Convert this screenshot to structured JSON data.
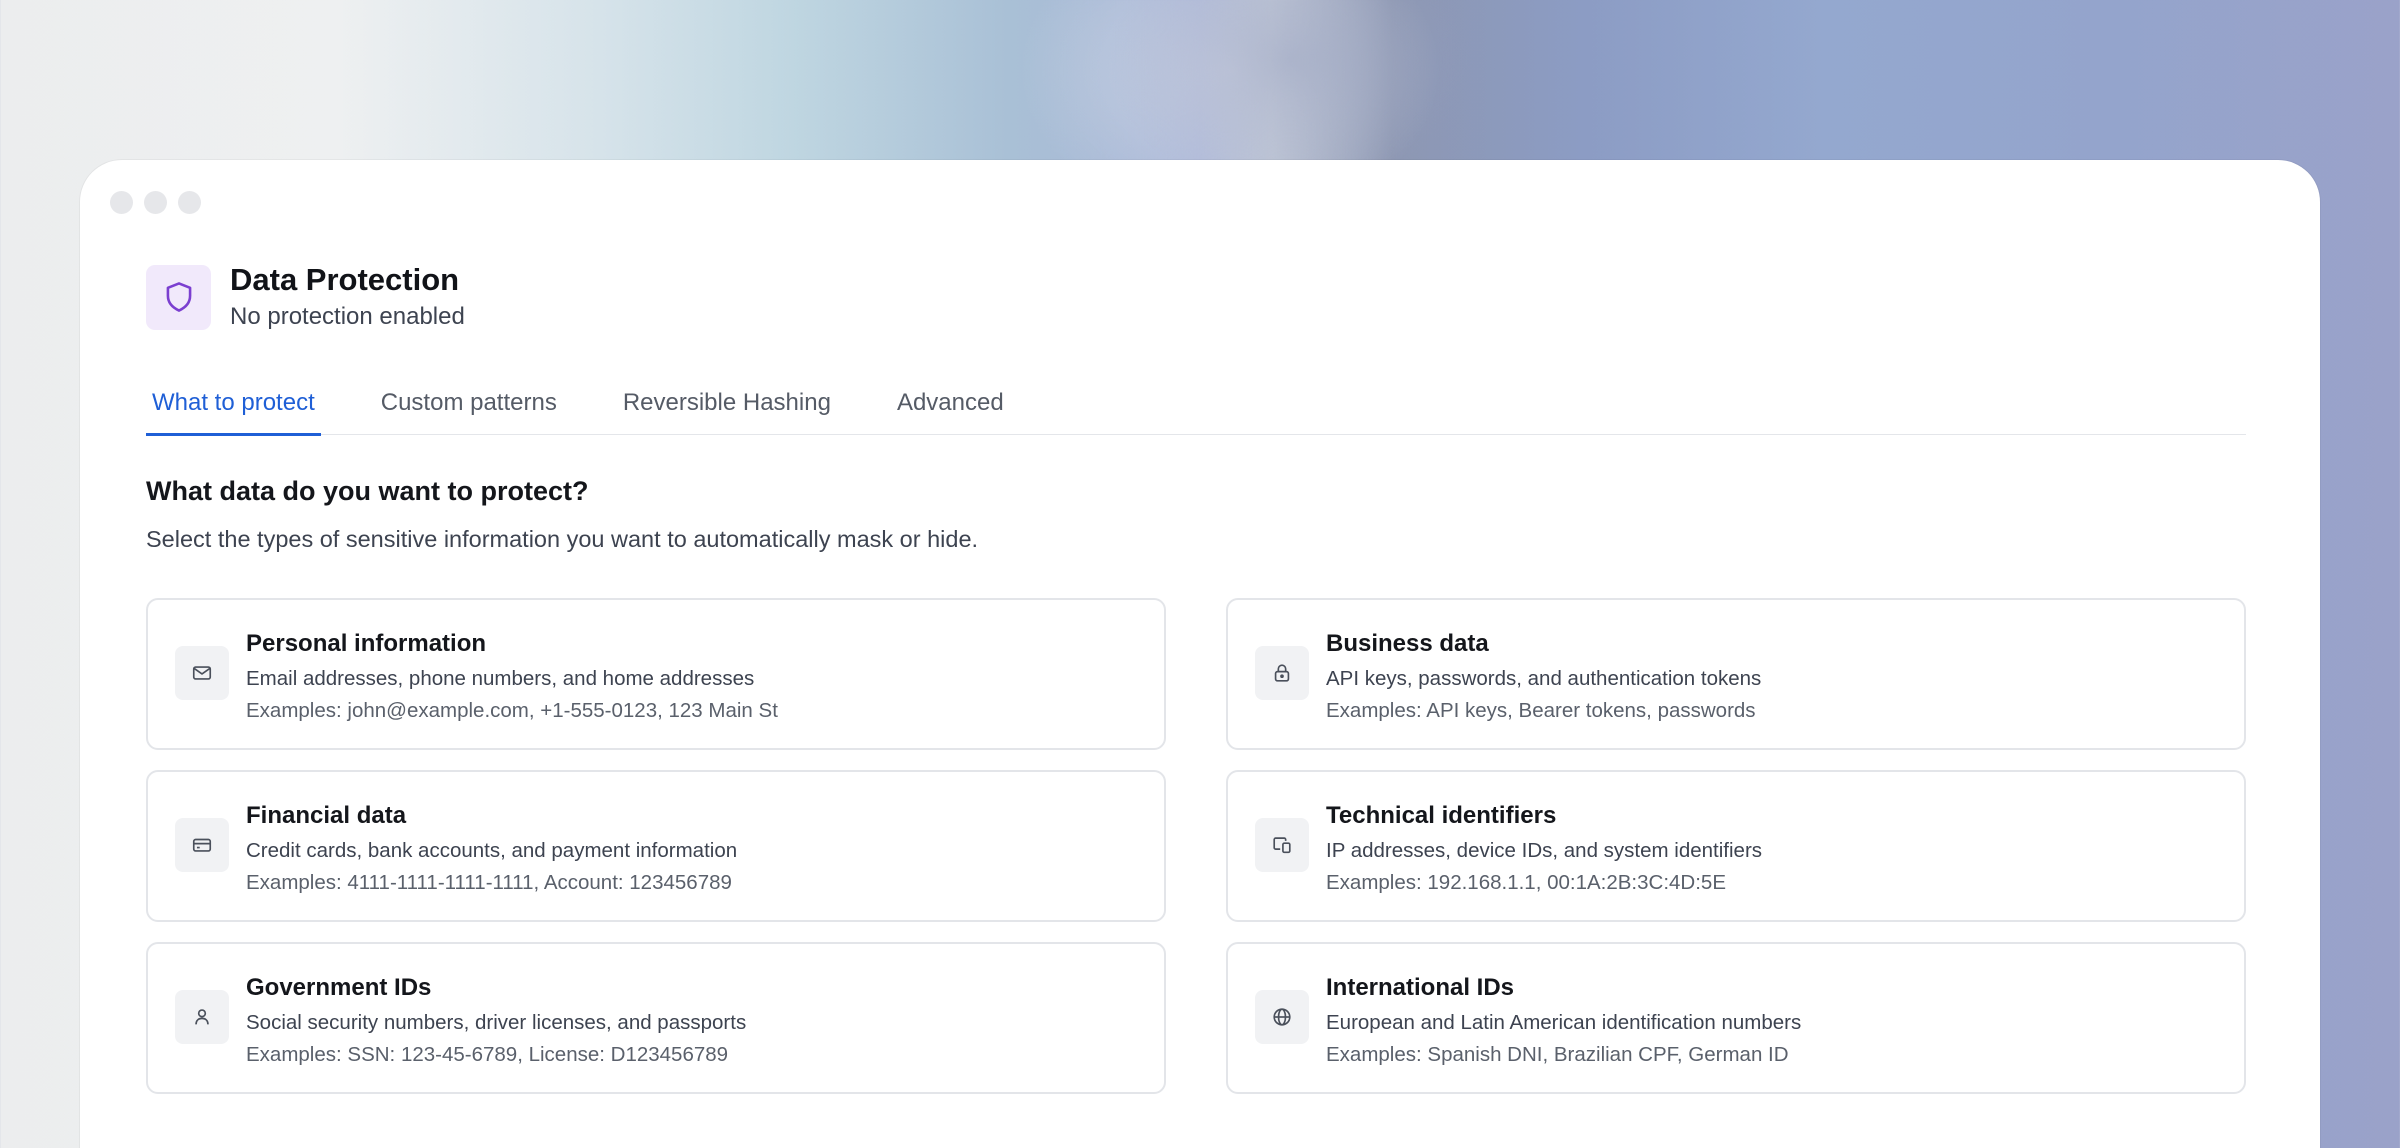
{
  "header": {
    "icon": "shield-icon",
    "accent": "#7b3fd0",
    "title": "Data Protection",
    "status": "No protection enabled"
  },
  "tabs": [
    {
      "label": "What to protect",
      "active": true
    },
    {
      "label": "Custom patterns",
      "active": false
    },
    {
      "label": "Reversible Hashing",
      "active": false
    },
    {
      "label": "Advanced",
      "active": false
    }
  ],
  "active_tab_color": "#1f5fd6",
  "section": {
    "title": "What data do you want to protect?",
    "description": "Select the types of sensitive information you want to automatically mask or hide."
  },
  "categories": [
    {
      "icon": "mail-icon",
      "title": "Personal information",
      "description": "Email addresses, phone numbers, and home addresses",
      "examples": "Examples: john@example.com, +1-555-0123, 123 Main St"
    },
    {
      "icon": "lock-icon",
      "title": "Business data",
      "description": "API keys, passwords, and authentication tokens",
      "examples": "Examples: API keys, Bearer tokens, passwords"
    },
    {
      "icon": "credit-card-icon",
      "title": "Financial data",
      "description": "Credit cards, bank accounts, and payment information",
      "examples": "Examples: 4111-1111-1111-1111, Account: 123456789"
    },
    {
      "icon": "devices-icon",
      "title": "Technical identifiers",
      "description": "IP addresses, device IDs, and system identifiers",
      "examples": "Examples: 192.168.1.1, 00:1A:2B:3C:4D:5E"
    },
    {
      "icon": "user-icon",
      "title": "Government IDs",
      "description": "Social security numbers, driver licenses, and passports",
      "examples": "Examples: SSN: 123-45-6789, License: D123456789"
    },
    {
      "icon": "globe-icon",
      "title": "International IDs",
      "description": "European and Latin American identification numbers",
      "examples": "Examples: Spanish DNI, Brazilian CPF, German ID"
    }
  ]
}
